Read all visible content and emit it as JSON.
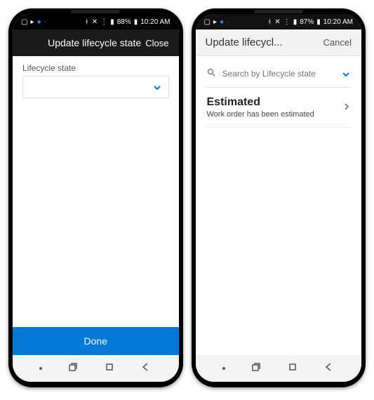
{
  "phone_left": {
    "status": {
      "battery": "88%",
      "time": "10:20 AM"
    },
    "appbar": {
      "title": "Update lifecycle state",
      "close": "Close"
    },
    "field": {
      "label": "Lifecycle state"
    },
    "done_label": "Done"
  },
  "phone_right": {
    "status": {
      "battery": "87%",
      "time": "10:20 AM"
    },
    "appbar": {
      "title": "Update lifecycl...",
      "cancel": "Cancel"
    },
    "search": {
      "placeholder": "Search by Lifecycle state"
    },
    "item": {
      "title": "Estimated",
      "subtitle": "Work order has been estimated"
    }
  }
}
